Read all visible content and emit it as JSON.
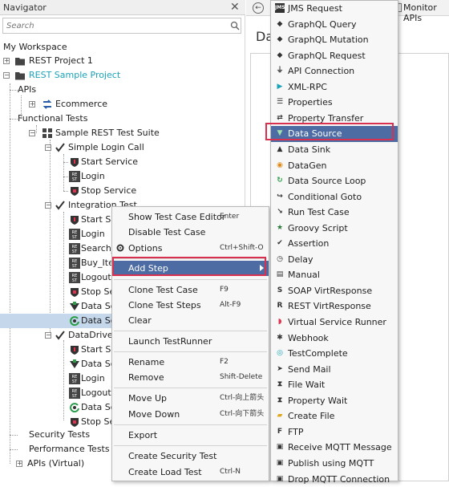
{
  "navigator": {
    "title": "Navigator",
    "close_glyph": "✕",
    "search_placeholder": "Search"
  },
  "tree": {
    "workspace": "My Workspace",
    "rest_project_1": "REST Project 1",
    "rest_sample_project": "REST Sample Project",
    "apis": "APIs",
    "ecommerce": "Ecommerce",
    "functional_tests": "Functional Tests",
    "suite": "Sample REST Test Suite",
    "simple_login_call": "Simple Login Call",
    "start_service": "Start Service",
    "login": "Login",
    "stop_service": "Stop Service",
    "integration_test": "Integration Test",
    "it_start": "Start Se",
    "it_login": "Login",
    "it_search": "Search_",
    "it_buy": "Buy_Ite",
    "it_logout": "Logout",
    "it_stop": "Stop Se",
    "it_data1": "Data So",
    "it_data2": "Data So",
    "datadriven": "DataDriven",
    "dd_start": "Start Se",
    "dd_data": "Data So",
    "dd_login": "Login",
    "dd_logout": "Logout",
    "dd_data2": "Data So",
    "dd_stop": "Stop Se",
    "security_tests": "Security Tests",
    "performance_tests": "Performance Tests",
    "apis_virtual": "APIs (Virtual)"
  },
  "right": {
    "title_partial": "Da",
    "monitor_label": "Monitor APIs"
  },
  "context_menu": [
    {
      "label": "Show Test Case Editor",
      "shortcut": "Enter"
    },
    {
      "label": "Disable Test Case",
      "shortcut": ""
    },
    {
      "label": "Options",
      "shortcut": "Ctrl+Shift-O"
    },
    {
      "label": "Add Step",
      "shortcut": ""
    },
    {
      "label": "Clone Test Case",
      "shortcut": "F9"
    },
    {
      "label": "Clone Test Steps",
      "shortcut": "Alt-F9"
    },
    {
      "label": "Clear",
      "shortcut": ""
    },
    {
      "label": "Launch TestRunner",
      "shortcut": ""
    },
    {
      "label": "Rename",
      "shortcut": "F2"
    },
    {
      "label": "Remove",
      "shortcut": "Shift-Delete"
    },
    {
      "label": "Move Up",
      "shortcut": "Ctrl-向上箭头"
    },
    {
      "label": "Move Down",
      "shortcut": "Ctrl-向下箭头"
    },
    {
      "label": "Export",
      "shortcut": ""
    },
    {
      "label": "Create Security Test",
      "shortcut": ""
    },
    {
      "label": "Create Load Test",
      "shortcut": "Ctrl-N"
    }
  ],
  "submenu": [
    {
      "label": "JMS Request",
      "icon": "jms-icon"
    },
    {
      "label": "GraphQL Query",
      "icon": "graphql-icon"
    },
    {
      "label": "GraphQL Mutation",
      "icon": "graphql-icon"
    },
    {
      "label": "GraphQL Request",
      "icon": "graphql-icon"
    },
    {
      "label": "API Connection",
      "icon": "plug-icon"
    },
    {
      "label": "XML-RPC",
      "icon": "xmlrpc-icon"
    },
    {
      "label": "Properties",
      "icon": "properties-icon"
    },
    {
      "label": "Property Transfer",
      "icon": "transfer-icon"
    },
    {
      "label": "Data Source",
      "icon": "datasource-icon"
    },
    {
      "label": "Data Sink",
      "icon": "datasink-icon"
    },
    {
      "label": "DataGen",
      "icon": "datagen-icon"
    },
    {
      "label": "Data Source Loop",
      "icon": "loop-icon"
    },
    {
      "label": "Conditional Goto",
      "icon": "goto-icon"
    },
    {
      "label": "Run Test Case",
      "icon": "run-icon"
    },
    {
      "label": "Groovy Script",
      "icon": "star-icon"
    },
    {
      "label": "Assertion",
      "icon": "assertion-icon"
    },
    {
      "label": "Delay",
      "icon": "clock-icon"
    },
    {
      "label": "Manual",
      "icon": "manual-icon"
    },
    {
      "label": "SOAP VirtResponse",
      "icon": "soap-icon"
    },
    {
      "label": "REST VirtResponse",
      "icon": "rest-icon"
    },
    {
      "label": "Virtual Service Runner",
      "icon": "virt-icon"
    },
    {
      "label": "Webhook",
      "icon": "webhook-icon"
    },
    {
      "label": "TestComplete",
      "icon": "testcomplete-icon"
    },
    {
      "label": "Send Mail",
      "icon": "mail-icon"
    },
    {
      "label": "File Wait",
      "icon": "filewait-icon"
    },
    {
      "label": "Property Wait",
      "icon": "propwait-icon"
    },
    {
      "label": "Create File",
      "icon": "folder-icon"
    },
    {
      "label": "FTP",
      "icon": "ftp-icon"
    },
    {
      "label": "Receive MQTT Message",
      "icon": "mqtt-icon"
    },
    {
      "label": "Publish using MQTT",
      "icon": "mqtt-icon"
    },
    {
      "label": "Drop MQTT Connection",
      "icon": "mqtt-icon"
    }
  ]
}
